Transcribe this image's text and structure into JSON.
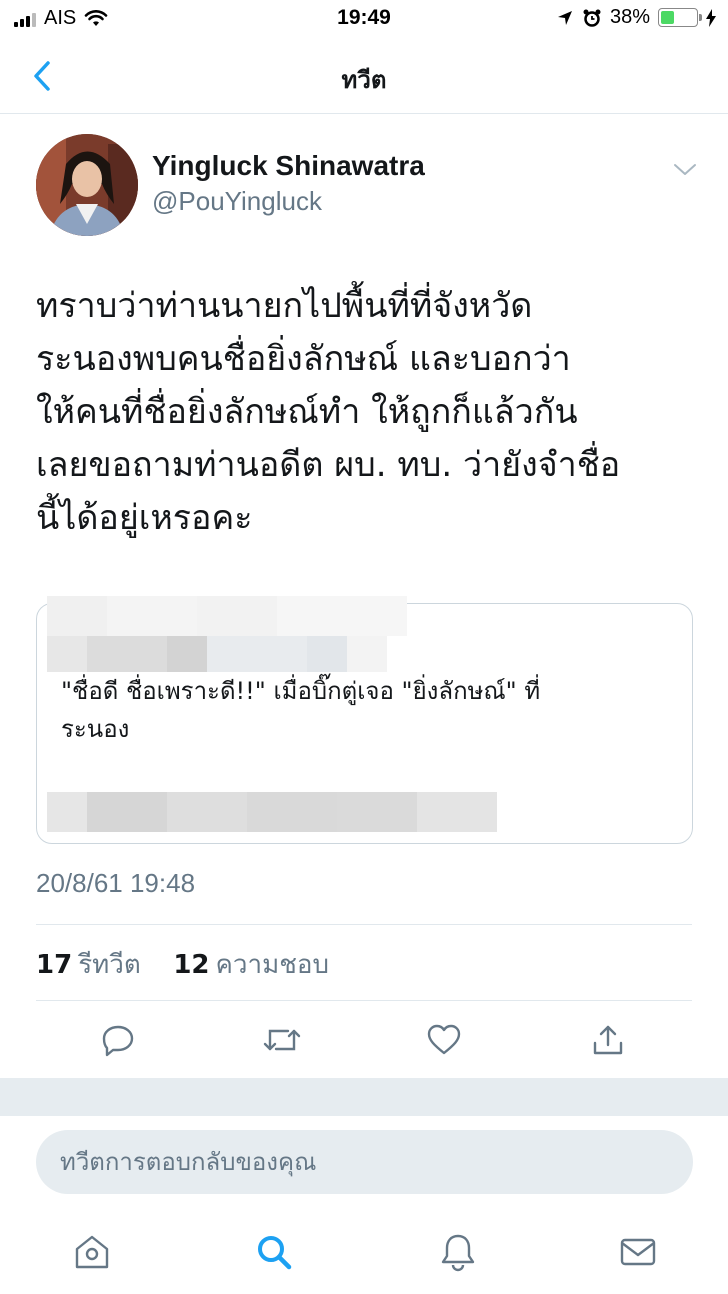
{
  "status_bar": {
    "carrier": "AIS",
    "time": "19:49",
    "battery_percent": "38%",
    "battery_level": 0.38
  },
  "nav": {
    "title": "ทวีต"
  },
  "tweet": {
    "author_name": "Yingluck Shinawatra",
    "author_handle": "@PouYingluck",
    "text_lines": [
      "ทราบว่าท่านนายกไปพื้นที่ที่จังหวัด",
      "ระนองพบคนชื่อยิ่งลักษณ์ และบอกว่า",
      " ให้คนที่ชื่อยิ่งลักษณ์ทำ ให้ถูกก็แล้วกัน",
      "เลยขอถามท่านอดีต ผบ. ทบ. ว่ายังจำชื่อ",
      "นี้ได้อยู่เหรอคะ"
    ],
    "quote": {
      "text_lines": [
        "\"ชื่อดี ชื่อเพราะดี!!\" เมื่อบิ๊กตู่เจอ \"ยิ่งลักษณ์\" ที่",
        "ระนอง"
      ]
    },
    "timestamp": "20/8/61 19:48",
    "retweet_count": "17",
    "retweet_label": "รีทวีต",
    "like_count": "12",
    "like_label": "ความชอบ"
  },
  "reply": {
    "placeholder": "ทวีตการตอบกลับของคุณ"
  },
  "colors": {
    "accent": "#1da1f2",
    "icon_gray": "#657786",
    "text": "#14171a",
    "divider": "#e1e8ed"
  },
  "icons": {
    "back": "chevron-left-icon",
    "menu": "chevron-down-icon",
    "reply": "reply-icon",
    "retweet": "retweet-icon",
    "like": "heart-icon",
    "share": "share-icon",
    "home": "home-icon",
    "search": "search-icon",
    "notifications": "bell-icon",
    "messages": "mail-icon"
  }
}
